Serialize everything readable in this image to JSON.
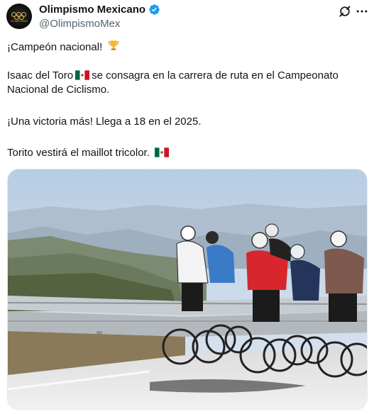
{
  "account": {
    "name": "Olimpismo Mexicano",
    "handle": "@OlimpismoMex",
    "avatar_text": "OLIMPISMO",
    "verified_color": "#1d9bf0"
  },
  "actions": {
    "grok_icon": "grok-icon",
    "more_icon": "more-icon"
  },
  "post": {
    "line1": "¡Campeón nacional!",
    "line1_emoji": "trophy",
    "line2a": "Isaac del Toro",
    "line2_emoji": "mexico-flag",
    "line2b": "se consagra en la carrera de ruta en el Campeonato",
    "line2c": "Nacional de Ciclismo.",
    "line3": "¡Una victoria más! Llega a 18 en el 2025.",
    "line4": "Torito vestirá el maillot tricolor.",
    "line4_emoji": "mexico-flag"
  },
  "media": {
    "subject": "cyclists-riding-uphill-photo",
    "sky_color": "#c9d9e8",
    "road_color": "#e9e9ea"
  }
}
